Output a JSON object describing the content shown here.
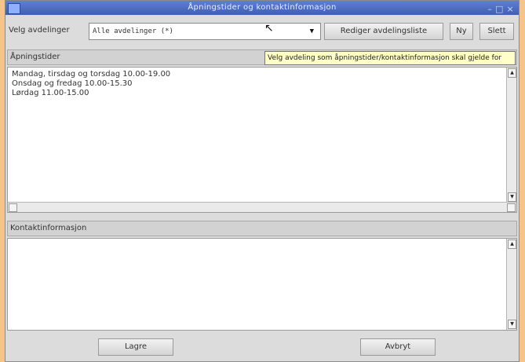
{
  "window": {
    "title": "Åpningstider og kontaktinformasjon"
  },
  "toolbar": {
    "department_label": "Velg avdelinger",
    "department_value": "Alle avdelinger (*)",
    "edit_list_label": "Rediger avdelingsliste",
    "ok_label": "Ny",
    "delete_label": "Slett"
  },
  "tooltip": {
    "text": "Velg avdeling som åpningstider/kontaktinformasjon skal gjelde for"
  },
  "opening_hours": {
    "header": "Åpningstider",
    "lines": [
      "Mandag, tirsdag og torsdag 10.00-19.00",
      "Onsdag og fredag 10.00-15.30",
      "Lørdag 11.00-15.00"
    ]
  },
  "contact": {
    "header": "Kontaktinformasjon",
    "text": ""
  },
  "footer": {
    "save_label": "Lagre",
    "cancel_label": "Avbryt"
  }
}
